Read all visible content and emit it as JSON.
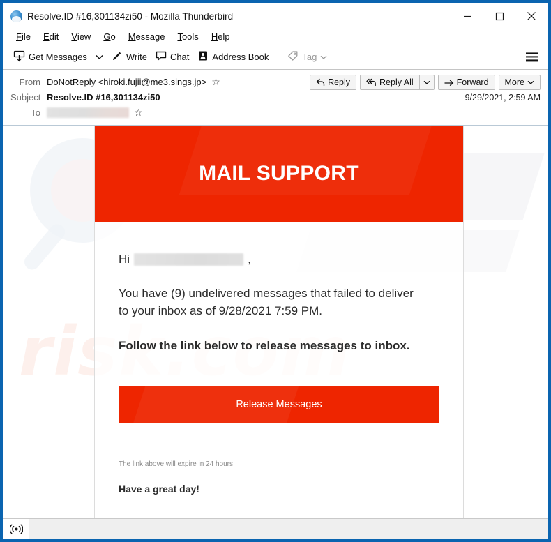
{
  "window": {
    "title": "Resolve.ID #16,301134zi50 - Mozilla Thunderbird",
    "app_icon": "thunderbird-icon",
    "controls": {
      "minimize": "minimize-icon",
      "maximize": "maximize-icon",
      "close": "close-icon"
    }
  },
  "menu": {
    "items": [
      {
        "label": "File",
        "accesskey": "F"
      },
      {
        "label": "Edit",
        "accesskey": "E"
      },
      {
        "label": "View",
        "accesskey": "V"
      },
      {
        "label": "Go",
        "accesskey": "G"
      },
      {
        "label": "Message",
        "accesskey": "M"
      },
      {
        "label": "Tools",
        "accesskey": "T"
      },
      {
        "label": "Help",
        "accesskey": "H"
      }
    ]
  },
  "toolbar": {
    "get_messages": "Get Messages",
    "write": "Write",
    "chat": "Chat",
    "address_book": "Address Book",
    "tag": "Tag",
    "menu_icon": "hamburger-icon"
  },
  "message_header": {
    "from_label": "From",
    "from_value": "DoNotReply <hiroki.fujii@me3.sings.jp>",
    "subject_label": "Subject",
    "subject_value": "Resolve.ID #16,301134zi50",
    "to_label": "To",
    "to_value_redacted": "",
    "date": "9/29/2021, 2:59 AM",
    "actions": {
      "reply": "Reply",
      "reply_all": "Reply All",
      "forward": "Forward",
      "more": "More"
    }
  },
  "email": {
    "banner_title": "MAIL SUPPORT",
    "banner_color": "#ee2500",
    "greeting_prefix": "Hi",
    "greeting_suffix": ",",
    "paragraph": "You have (9) undelivered messages that failed to deliver to your inbox as of 9/28/2021 7:59 PM.",
    "cta_text": "Follow the link below to release messages to inbox.",
    "button_label": "Release Messages",
    "expire_note": "The link above will expire in 24 hours",
    "signoff": "Have a great day!",
    "watermark_text": "risk.com"
  },
  "status_bar": {
    "online_icon": "connectivity-icon",
    "text": ""
  }
}
